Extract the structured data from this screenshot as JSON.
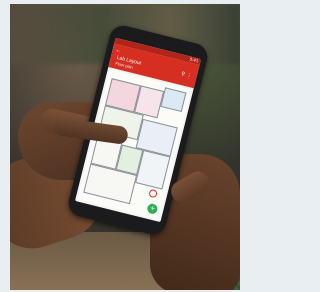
{
  "app": {
    "title": "Lab Layout",
    "subtitle": "Floor plan",
    "status_time": "5:41"
  },
  "colors": {
    "app_bar": "#d62f21",
    "status_bar": "#b42318",
    "fab": "#2eae52"
  },
  "icons": {
    "back": "back-arrow-icon",
    "search": "search-icon",
    "menu": "more-icon",
    "add": "plus-icon"
  }
}
